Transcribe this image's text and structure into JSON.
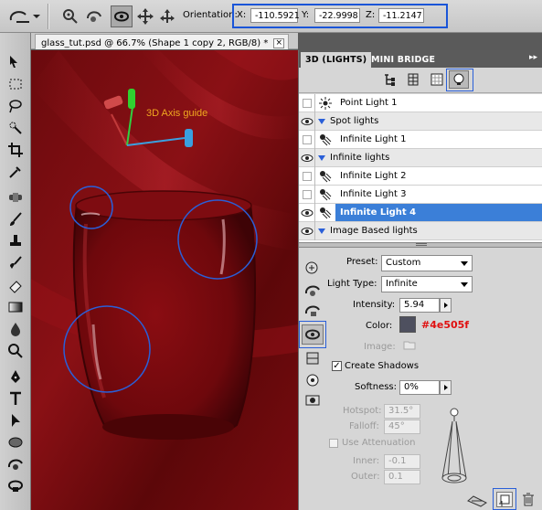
{
  "orientation": {
    "label": "Orientation:",
    "x_label": "X:",
    "x_value": "-110.5921",
    "y_label": "Y:",
    "y_value": "-22.9998",
    "z_label": "Z:",
    "z_value": "-11.2147"
  },
  "document_tab": {
    "title": "glass_tut.psd @ 66.7% (Shape 1 copy 2, RGB/8) *",
    "close": "×"
  },
  "canvas": {
    "axis_label": "3D Axis guide"
  },
  "panel": {
    "tab_active": "3D (LIGHTS)",
    "tab_inactive": "MINI BRIDGE",
    "menu": "▸▸"
  },
  "lights": [
    {
      "kind": "item",
      "name": "Point Light 1",
      "icon": "point-light-icon",
      "visible": false,
      "selected": false
    },
    {
      "kind": "group",
      "name": "Spot lights",
      "visible": true
    },
    {
      "kind": "item",
      "name": "Infinite Light 1",
      "icon": "infinite-light-icon",
      "visible": false,
      "selected": false
    },
    {
      "kind": "group",
      "name": "Infinite lights",
      "visible": true
    },
    {
      "kind": "item",
      "name": "Infinite Light 2",
      "icon": "infinite-light-icon",
      "visible": false,
      "selected": false
    },
    {
      "kind": "item",
      "name": "Infinite Light 3",
      "icon": "infinite-light-icon",
      "visible": false,
      "selected": false
    },
    {
      "kind": "item",
      "name": "Infinite Light 4",
      "icon": "infinite-light-icon",
      "visible": true,
      "selected": true
    },
    {
      "kind": "group",
      "name": "Image Based lights",
      "visible": true
    }
  ],
  "props": {
    "preset_label": "Preset:",
    "preset_value": "Custom",
    "light_type_label": "Light Type:",
    "light_type_value": "Infinite",
    "intensity_label": "Intensity:",
    "intensity_value": "5.94",
    "color_label": "Color:",
    "color_swatch": "#4e505f",
    "color_annotation": "#4e505f",
    "image_label": "Image:",
    "create_shadows_label": "Create Shadows",
    "create_shadows_checked": true,
    "softness_label": "Softness:",
    "softness_value": "0%",
    "hotspot_label": "Hotspot:",
    "hotspot_value": "31.5°",
    "falloff_label": "Falloff:",
    "falloff_value": "45°",
    "use_attenuation_label": "Use Attenuation",
    "inner_label": "Inner:",
    "inner_value": "-0.1",
    "outer_label": "Outer:",
    "outer_value": "0.1"
  },
  "colors": {
    "canvas_red": "#7a0c10",
    "highlight_blue": "#2a5fd8",
    "annotation_red": "#e01010",
    "axis_label_color": "#e8a020",
    "selection_blue": "#3b7fd8"
  }
}
